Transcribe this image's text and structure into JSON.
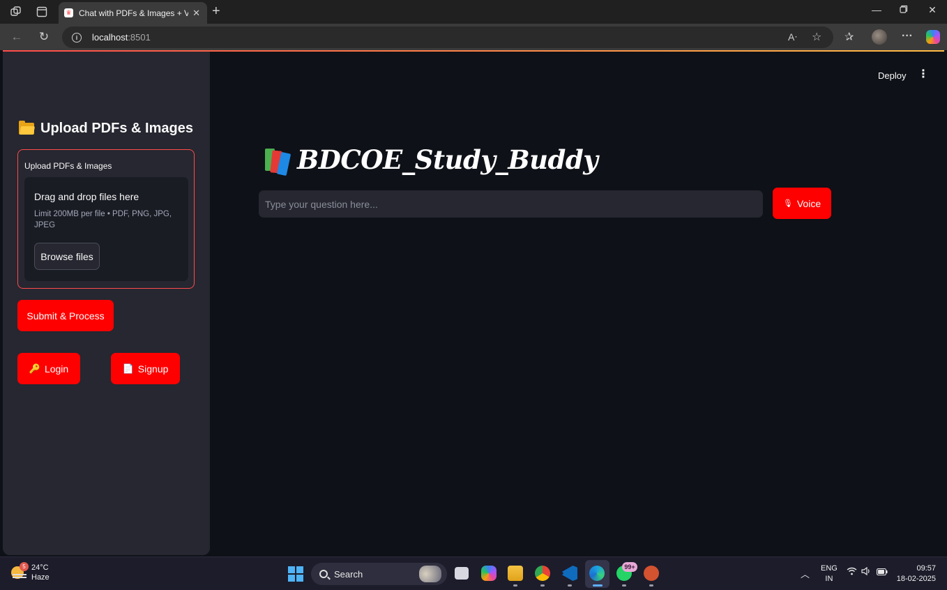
{
  "browser": {
    "tab_title": "Chat with PDFs & Images + Voice",
    "url_host": "localhost",
    "url_port": ":8501"
  },
  "app": {
    "header": {
      "deploy_label": "Deploy",
      "menu_icon": "vertical-ellipsis-icon"
    },
    "sidebar": {
      "title": "Upload PDFs & Images",
      "title_icon": "folder-icon",
      "uploader": {
        "label": "Upload PDFs & Images",
        "dropzone_title": "Drag and drop files here",
        "dropzone_limit": "Limit 200MB per file • PDF, PNG, JPG, JPEG",
        "browse_label": "Browse files"
      },
      "submit_label": "Submit & Process",
      "login_label": "Login",
      "login_icon": "🔑",
      "signup_label": "Signup",
      "signup_icon": "📄"
    },
    "main": {
      "title": "BDCOE_Study_Buddy",
      "title_icon": "books-icon",
      "question_placeholder": "Type your question here...",
      "voice_label": "Voice",
      "voice_icon": "🎙"
    },
    "colors": {
      "primary": "#ff0000",
      "accent_border": "#ff4b4b",
      "background": "#0e1117",
      "sidebar": "#262730"
    }
  },
  "taskbar": {
    "weather_badge": "5",
    "weather_temp": "24°C",
    "weather_desc": "Haze",
    "search_label": "Search",
    "whatsapp_badge": "99+",
    "lang_top": "ENG",
    "lang_bottom": "IN",
    "time": "09:57",
    "date": "18-02-2025"
  }
}
